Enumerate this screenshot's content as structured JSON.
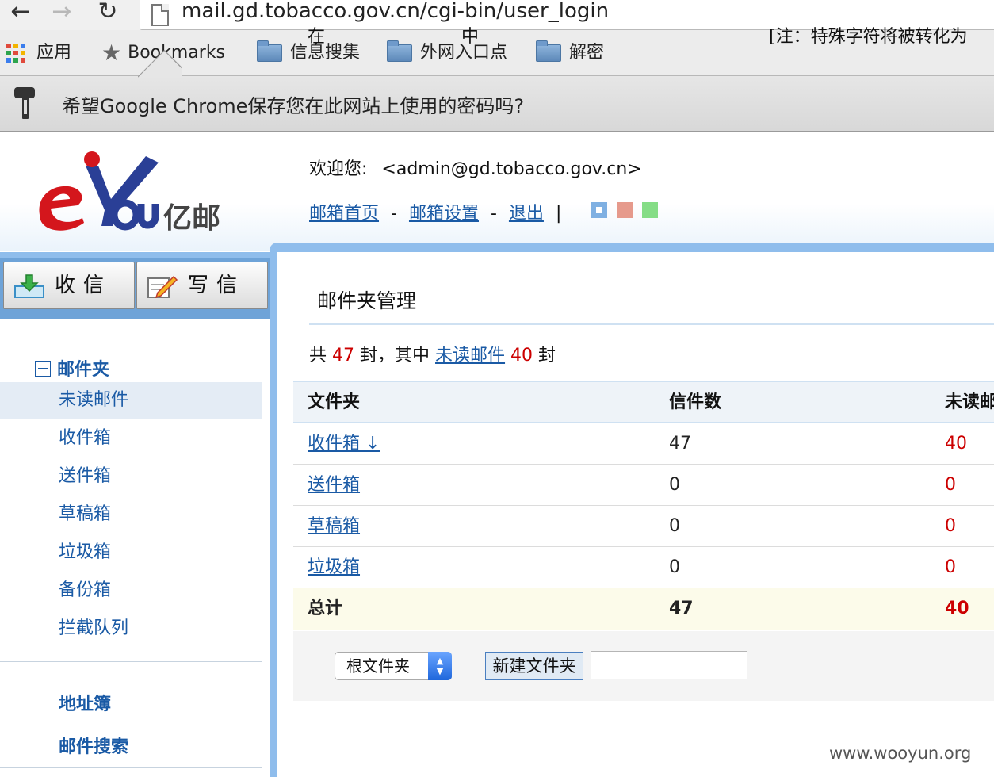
{
  "browser": {
    "url": "mail.gd.tobacco.gov.cn/cgi-bin/user_login",
    "bookmarks": {
      "apps": "应用",
      "bookmarks": "Bookmarks",
      "folder1": "信息搜集",
      "folder2": "外网入口点",
      "folder3": "解密"
    },
    "password_prompt": "希望Google Chrome保存您在此网站上使用的密码吗?"
  },
  "header": {
    "logo_text": "亿邮",
    "welcome_label": "欢迎您:",
    "user_email": "<admin@gd.tobacco.gov.cn>",
    "link_home": "邮箱首页",
    "link_settings": "邮箱设置",
    "link_logout": "退出",
    "separator": "-",
    "pipe": "|",
    "theme_colors": [
      "#7fb0e2",
      "#e69a8c",
      "#85dd86"
    ]
  },
  "sidebar": {
    "receive_label": "收信",
    "write_label": "写信",
    "folder_section": "邮件夹",
    "items": [
      "未读邮件",
      "收件箱",
      "送件箱",
      "草稿箱",
      "垃圾箱",
      "备份箱",
      "拦截队列"
    ],
    "address_book": "地址簿",
    "mail_search": "邮件搜索"
  },
  "main": {
    "title": "邮件夹管理",
    "summary": {
      "prefix": "共",
      "total": "47",
      "mid": "封，其中",
      "unread_link": "未读邮件",
      "unread": "40",
      "suffix": "封"
    },
    "table": {
      "headers": [
        "文件夹",
        "信件数",
        "未读邮"
      ],
      "rows": [
        {
          "name": "收件箱 ↓",
          "count": "47",
          "unread": "40"
        },
        {
          "name": "送件箱",
          "count": "0",
          "unread": "0"
        },
        {
          "name": "草稿箱",
          "count": "0",
          "unread": "0"
        },
        {
          "name": "垃圾箱",
          "count": "0",
          "unread": "0"
        }
      ],
      "total": {
        "label": "总计",
        "count": "47",
        "unread": "40"
      }
    },
    "new_folder": {
      "in_label": "在",
      "parent_select": "根文件夹",
      "mid_label": "中",
      "button": "新建文件夹",
      "input_value": "",
      "note": "[注：特殊字符将被转化为"
    }
  },
  "watermark": "www.wooyun.org"
}
